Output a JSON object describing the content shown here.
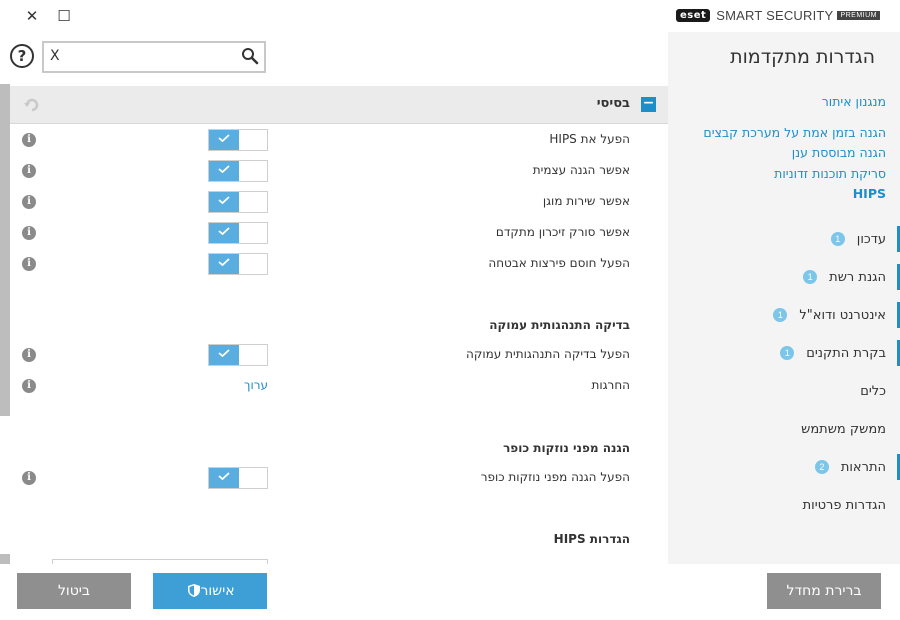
{
  "window": {
    "close_glyph": "✕",
    "maximize_glyph": "☐",
    "brand_logo": "eset",
    "brand_name": "SMART SECURITY",
    "brand_edition": "PREMIUM"
  },
  "sidebar": {
    "title": "הגדרות מתקדמות",
    "sub_links": [
      {
        "label": "מנגנון איתור"
      },
      {
        "label": "הגנה בזמן אמת על מערכת קבצים"
      },
      {
        "label": "הגנה מבוססת ענן"
      },
      {
        "label": "סריקת תוכנות זדוניות"
      },
      {
        "label": "HIPS"
      }
    ],
    "nav": [
      {
        "label": "עדכון",
        "badge": "1"
      },
      {
        "label": "הגנת רשת",
        "badge": "1"
      },
      {
        "label": "אינטרנט ודוא\"ל",
        "badge": "1"
      },
      {
        "label": "בקרת התקנים",
        "badge": "1"
      },
      {
        "label": "כלים",
        "badge": ""
      },
      {
        "label": "ממשק משתמש",
        "badge": ""
      },
      {
        "label": "התראות",
        "badge": "2"
      },
      {
        "label": "הגדרות פרטיות",
        "badge": ""
      }
    ]
  },
  "search": {
    "help_glyph": "?",
    "clear_glyph": "X",
    "value": "",
    "placeholder": ""
  },
  "section": {
    "title": "בסיסי",
    "collapse_glyph": "−"
  },
  "settings": [
    {
      "label": "הפעל את HIPS",
      "state": "on"
    },
    {
      "label": "אפשר הגנה עצמית",
      "state": "on"
    },
    {
      "label": "אפשר שירות מוגן",
      "state": "on"
    },
    {
      "label": "אפשר סורק זיכרון מתקדם",
      "state": "on"
    },
    {
      "label": "הפעל חוסם פירצות אבטחה",
      "state": "on"
    }
  ],
  "deep_behavior": {
    "heading": "בדיקה התנהגותית עמוקה",
    "enable_label": "הפעל בדיקה התנהגותית עמוקה",
    "exclusions_label": "החרגות",
    "edit_label": "ערוך"
  },
  "ransomware": {
    "heading": "הגנה מפני נוזקות כופר",
    "enable_label": "הפעל הגנה מפני נוזקות כופר"
  },
  "hips_settings": {
    "heading": "הגדרות HIPS"
  },
  "info_glyph": "i",
  "footer": {
    "cancel_label": "ביטול",
    "ok_label": "אישור",
    "default_label": "ברירת מחדל"
  },
  "colors": {
    "accent": "#1e8ec8",
    "toggle_on": "#5aaedf",
    "button_gray": "#8f8f8f",
    "button_blue": "#3d9fd6"
  }
}
